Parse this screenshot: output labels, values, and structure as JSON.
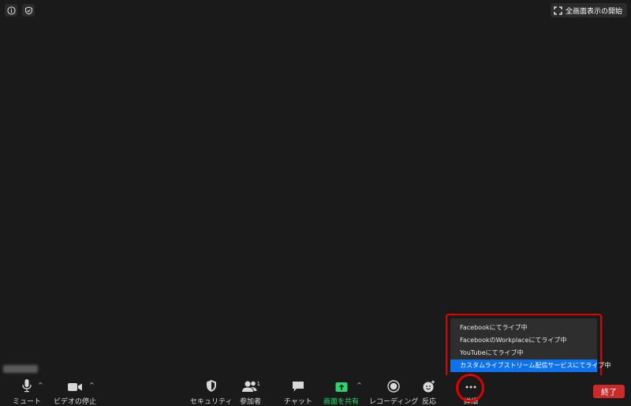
{
  "top": {
    "icons": [
      "info-icon",
      "shield-check-icon"
    ],
    "fullscreen_label": "全画面表示の開始"
  },
  "toolbar": {
    "mute_label": "ミュート",
    "video_label": "ビデオの停止",
    "security_label": "セキュリティ",
    "participants_label": "参加者",
    "participants_count": "1",
    "chat_label": "チャット",
    "share_label": "画面を共有",
    "record_label": "レコーディング",
    "reactions_label": "反応",
    "more_label": "詳細",
    "end_label": "終了",
    "caret": "^"
  },
  "more_menu": {
    "items": [
      "Facebookにてライブ中",
      "FacebookのWorkplaceにてライブ中",
      "YouTubeにてライブ中",
      "カスタムライブストリーム配信サービスにてライブ中"
    ],
    "selected_index": 3
  },
  "colors": {
    "background": "#1a1a1a",
    "share_accent": "#2dd36f",
    "end_button": "#c92a2a",
    "menu_selected": "#0e72ed",
    "highlight": "#e00000"
  }
}
